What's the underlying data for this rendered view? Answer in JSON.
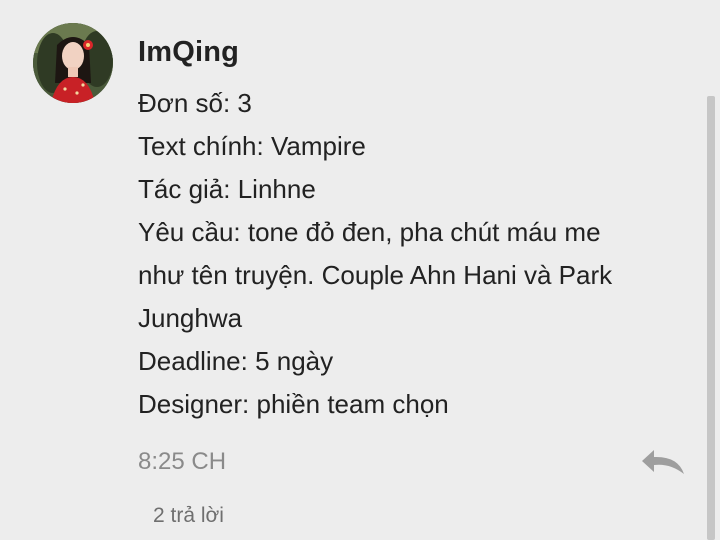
{
  "comment": {
    "username": "ImQing",
    "lines": [
      "Đơn số: 3",
      "Text chính: Vampire",
      "Tác giả: Linhne",
      "Yêu cầu: tone đỏ đen, pha chút máu me",
      "như tên truyện. Couple Ahn Hani và Park",
      "Junghwa",
      "Deadline: 5 ngày",
      "Designer: phiền team chọn"
    ],
    "timestamp": "8:25 CH",
    "replies_label": "2 trả lời"
  },
  "icons": {
    "reply": "reply-arrow-icon",
    "avatar": "user-avatar"
  },
  "colors": {
    "background": "#ededed",
    "text": "#222222",
    "muted": "#8a8a8a",
    "icon": "#9e9e9e",
    "scrollbar": "#c6c6c6"
  }
}
